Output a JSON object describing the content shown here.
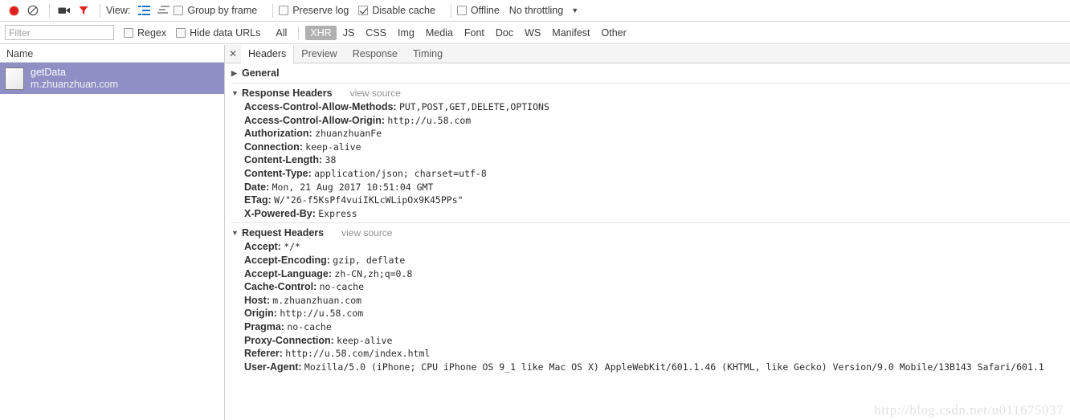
{
  "toolbar": {
    "record_icon": "record-dot-icon",
    "clear_icon": "clear-circle-slash-icon",
    "camera_icon": "screenshot-camera-icon",
    "filter_icon": "filter-funnel-icon",
    "view_label": "View:",
    "view_list_icon": "list-view-icon",
    "view_waterfall_icon": "waterfall-view-icon",
    "group_by_frame": {
      "label": "Group by frame",
      "checked": false
    },
    "preserve_log": {
      "label": "Preserve log",
      "checked": false
    },
    "disable_cache": {
      "label": "Disable cache",
      "checked": true
    },
    "offline": {
      "label": "Offline",
      "checked": false
    },
    "throttling": "No throttling",
    "throttling_caret_icon": "chevron-down-icon"
  },
  "filterbar": {
    "filter_placeholder": "Filter",
    "filter_value": "",
    "regex": {
      "label": "Regex",
      "checked": false
    },
    "hide_data_urls": {
      "label": "Hide data URLs",
      "checked": false
    },
    "types": [
      "All",
      "XHR",
      "JS",
      "CSS",
      "Img",
      "Media",
      "Font",
      "Doc",
      "WS",
      "Manifest",
      "Other"
    ],
    "active_type": "XHR"
  },
  "requests_panel": {
    "column_header": "Name",
    "selected_index": 0,
    "rows": [
      {
        "name": "getData",
        "domain": "m.zhuanzhuan.com",
        "icon": "document-icon",
        "selected": true
      }
    ]
  },
  "details_panel": {
    "close_icon": "close-icon",
    "tabs": [
      "Headers",
      "Preview",
      "Response",
      "Timing"
    ],
    "active_tab": "Headers",
    "sections": [
      {
        "title": "General",
        "expanded": false,
        "triangle": "▶",
        "view_source": "",
        "rows": []
      },
      {
        "title": "Response Headers",
        "expanded": true,
        "triangle": "▼",
        "view_source": "view source",
        "rows": [
          {
            "name": "Access-Control-Allow-Methods:",
            "value": "PUT,POST,GET,DELETE,OPTIONS"
          },
          {
            "name": "Access-Control-Allow-Origin:",
            "value": "http://u.58.com"
          },
          {
            "name": "Authorization:",
            "value": "zhuanzhuanFe"
          },
          {
            "name": "Connection:",
            "value": "keep-alive"
          },
          {
            "name": "Content-Length:",
            "value": "38"
          },
          {
            "name": "Content-Type:",
            "value": "application/json; charset=utf-8"
          },
          {
            "name": "Date:",
            "value": "Mon, 21 Aug 2017 10:51:04 GMT"
          },
          {
            "name": "ETag:",
            "value": "W/\"26-f5KsPf4vuiIKLcWLipOx9K45PPs\""
          },
          {
            "name": "X-Powered-By:",
            "value": "Express"
          }
        ]
      },
      {
        "title": "Request Headers",
        "expanded": true,
        "triangle": "▼",
        "view_source": "view source",
        "rows": [
          {
            "name": "Accept:",
            "value": "*/*"
          },
          {
            "name": "Accept-Encoding:",
            "value": "gzip, deflate"
          },
          {
            "name": "Accept-Language:",
            "value": "zh-CN,zh;q=0.8"
          },
          {
            "name": "Cache-Control:",
            "value": "no-cache"
          },
          {
            "name": "Host:",
            "value": "m.zhuanzhuan.com"
          },
          {
            "name": "Origin:",
            "value": "http://u.58.com"
          },
          {
            "name": "Pragma:",
            "value": "no-cache"
          },
          {
            "name": "Proxy-Connection:",
            "value": "keep-alive"
          },
          {
            "name": "Referer:",
            "value": "http://u.58.com/index.html"
          },
          {
            "name": "User-Agent:",
            "value": "Mozilla/5.0 (iPhone; CPU iPhone OS 9_1 like Mac OS X) AppleWebKit/601.1.46 (KHTML, like Gecko) Version/9.0 Mobile/13B143 Safari/601.1"
          }
        ]
      }
    ]
  },
  "watermark": "http://blog.csdn.net/u011675037",
  "colors": {
    "accent_red": "#e02020",
    "view_icon_blue": "#1a73c8",
    "selection_purple": "#8f8fc5",
    "active_type_bg": "#b0b0b0"
  }
}
